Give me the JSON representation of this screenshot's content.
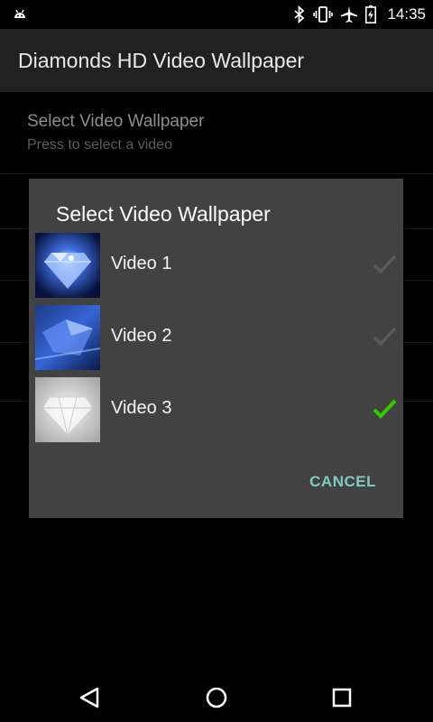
{
  "status_bar": {
    "time": "14:35",
    "icons": [
      "android-debug-icon",
      "bluetooth-icon",
      "vibrate-icon",
      "airplane-mode-icon",
      "battery-charging-icon"
    ]
  },
  "app_bar": {
    "title": "Diamonds HD Video Wallpaper"
  },
  "preferences": {
    "items": [
      {
        "title": "Select Video Wallpaper",
        "summary": "Press to select a video"
      }
    ]
  },
  "dialog": {
    "title": "Select Video Wallpaper",
    "items": [
      {
        "label": "Video 1",
        "selected": false
      },
      {
        "label": "Video 2",
        "selected": false
      },
      {
        "label": "Video 3",
        "selected": true
      }
    ],
    "cancel_label": "CANCEL"
  },
  "colors": {
    "accent": "#80cbc4",
    "check_selected": "#33cc00",
    "dialog_bg": "#424242",
    "app_bar_bg": "#212121"
  },
  "nav_bar": {
    "icons": [
      "back-icon",
      "home-icon",
      "recents-icon"
    ]
  }
}
